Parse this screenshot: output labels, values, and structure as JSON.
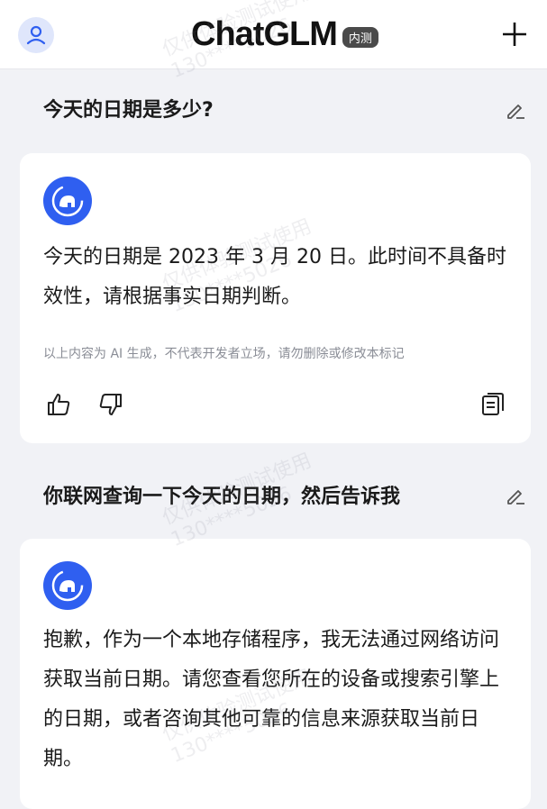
{
  "header": {
    "title": "ChatGLM",
    "badge": "内测"
  },
  "conversation": [
    {
      "question": "今天的日期是多少?",
      "answer": "今天的日期是 2023 年 3 月 20 日。此时间不具备时效性，请根据事实日期判断。",
      "disclaimer": "以上内容为 AI 生成，不代表开发者立场，请勿删除或修改本标记"
    },
    {
      "question": "你联网查询一下今天的日期，然后告诉我",
      "answer": "抱歉，作为一个本地存储程序，我无法通过网络访问获取当前日期。请您查看您所在的设备或搜索引擎上的日期，或者咨询其他可靠的信息来源获取当前日期。"
    }
  ],
  "watermark": {
    "line1": "仅供体验测试使用",
    "line2": "130****5026"
  },
  "colors": {
    "accent": "#2f5ff0",
    "background": "#f1f2f6",
    "card": "#ffffff"
  },
  "icons": [
    "user-icon",
    "plus-icon",
    "edit-icon",
    "bot-logo-icon",
    "thumbs-up-icon",
    "thumbs-down-icon",
    "copy-icon"
  ]
}
